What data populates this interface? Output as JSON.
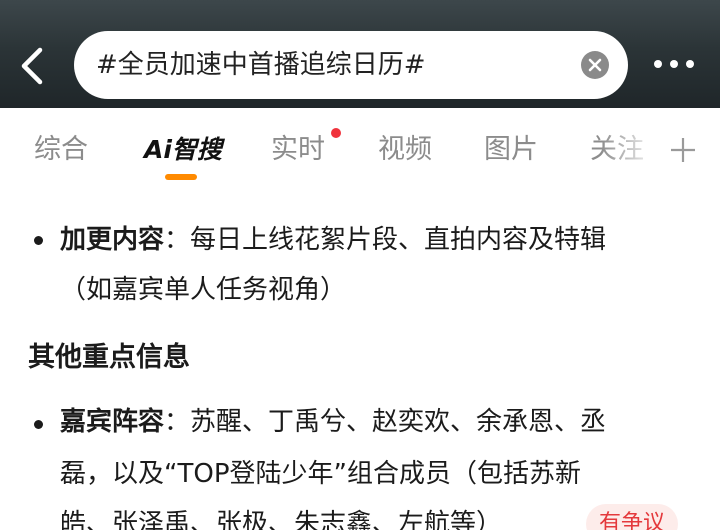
{
  "search": {
    "query": "#全员加速中首播追综日历#"
  },
  "tabs": [
    {
      "label": "综合"
    },
    {
      "label": "Ai智搜"
    },
    {
      "label": "实时"
    },
    {
      "label": "视频"
    },
    {
      "label": "图片"
    },
    {
      "label": "关注"
    }
  ],
  "content": {
    "item1": {
      "term": "加更内容",
      "line1": "：每日上线花絮片段、直拍内容及特辑",
      "line2": "（如嘉宾单人任务视角）"
    },
    "section_title": "其他重点信息",
    "item2": {
      "term": "嘉宾阵容",
      "line1": "：苏醒、丁禹兮、赵奕欢、余承恩、丞",
      "line2": "磊，以及“TOP登陆少年”组合成员（包括苏新",
      "line3": "皓、张泽禹、张极、朱志鑫、左航等）"
    },
    "dispute_badge": "有争议"
  },
  "icons": {
    "back": "chevron-left-icon",
    "clear": "clear-icon",
    "more": "more-dots-icon",
    "add": "plus-icon"
  },
  "colors": {
    "accent": "#ff8a00",
    "red_dot": "#f0323c",
    "badge_text": "#e4393c",
    "badge_bg": "#fdecea",
    "inactive_tab": "#8c8c8c"
  }
}
